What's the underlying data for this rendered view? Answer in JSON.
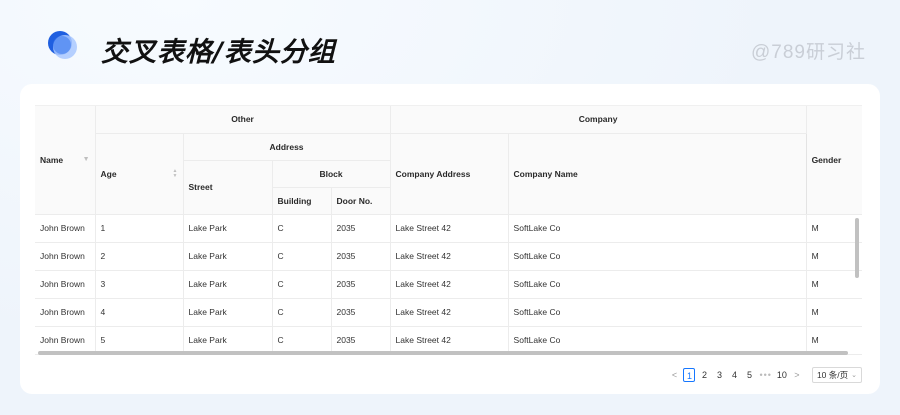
{
  "header": {
    "title": "交叉表格/表头分组",
    "watermark": "@789研习社"
  },
  "colors": {
    "accent": "#1677ff",
    "logo_dark": "#1f5fe0",
    "logo_light": "#a9c8ff"
  },
  "table": {
    "group_headers": {
      "other": "Other",
      "company": "Company",
      "address": "Address",
      "block": "Block"
    },
    "columns": {
      "name": "Name",
      "age": "Age",
      "street": "Street",
      "building": "Building",
      "door": "Door No.",
      "company_address": "Company Address",
      "company_name": "Company Name",
      "gender": "Gender"
    },
    "rows": [
      {
        "name": "John Brown",
        "age": "1",
        "street": "Lake Park",
        "building": "C",
        "door": "2035",
        "company_address": "Lake Street 42",
        "company_name": "SoftLake Co",
        "gender": "M"
      },
      {
        "name": "John Brown",
        "age": "2",
        "street": "Lake Park",
        "building": "C",
        "door": "2035",
        "company_address": "Lake Street 42",
        "company_name": "SoftLake Co",
        "gender": "M"
      },
      {
        "name": "John Brown",
        "age": "3",
        "street": "Lake Park",
        "building": "C",
        "door": "2035",
        "company_address": "Lake Street 42",
        "company_name": "SoftLake Co",
        "gender": "M"
      },
      {
        "name": "John Brown",
        "age": "4",
        "street": "Lake Park",
        "building": "C",
        "door": "2035",
        "company_address": "Lake Street 42",
        "company_name": "SoftLake Co",
        "gender": "M"
      },
      {
        "name": "John Brown",
        "age": "5",
        "street": "Lake Park",
        "building": "C",
        "door": "2035",
        "company_address": "Lake Street 42",
        "company_name": "SoftLake Co",
        "gender": "M"
      }
    ]
  },
  "pagination": {
    "prev": "<",
    "pages": [
      "1",
      "2",
      "3",
      "4",
      "5"
    ],
    "ellipsis": "•••",
    "last": "10",
    "next": ">",
    "page_size": "10 条/页"
  },
  "icons": {
    "filter": "filter-icon",
    "sort": "sort-icon",
    "chevron": "chevron-down-icon"
  }
}
